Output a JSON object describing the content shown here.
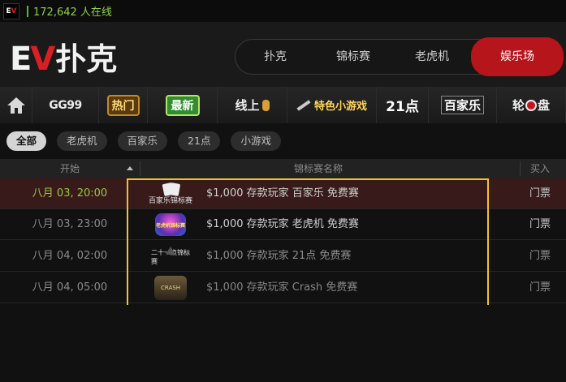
{
  "status_bar": {
    "app_icon_text": "EV",
    "online_text": "172,642 人在线"
  },
  "header": {
    "logo_ev": "EV",
    "logo_title": "扑克",
    "nav": [
      {
        "label": "扑克",
        "active": false
      },
      {
        "label": "锦标赛",
        "active": false
      },
      {
        "label": "老虎机",
        "active": false
      },
      {
        "label": "娱乐场",
        "active": true
      }
    ]
  },
  "categories": [
    {
      "label": "GG99"
    },
    {
      "label": "热门"
    },
    {
      "label": "最新"
    },
    {
      "label": "线上"
    },
    {
      "label": "特色小游戏"
    },
    {
      "label": "21点"
    },
    {
      "label": "百家乐"
    },
    {
      "label_a": "轮",
      "label_b": "盘"
    }
  ],
  "filters": [
    {
      "label": "全部",
      "active": true
    },
    {
      "label": "老虎机",
      "active": false
    },
    {
      "label": "百家乐",
      "active": false
    },
    {
      "label": "21点",
      "active": false
    },
    {
      "label": "小游戏",
      "active": false
    }
  ],
  "table": {
    "columns": {
      "start": "开始",
      "name": "锦标赛名称",
      "buyin": "买入"
    },
    "rows": [
      {
        "start": "八月 03, 20:00",
        "thumb": "百家乐锦标赛",
        "name": "$1,000 存款玩家 百家乐 免费赛",
        "buyin": "门票"
      },
      {
        "start": "八月 03, 23:00",
        "thumb": "老虎机锦标赛",
        "name": "$1,000 存款玩家 老虎机 免费赛",
        "buyin": "门票"
      },
      {
        "start": "八月 04, 02:00",
        "thumb": "二十一点锦标赛",
        "name": "$1,000 存款玩家 21点 免费赛",
        "buyin": "门票"
      },
      {
        "start": "八月 04, 05:00",
        "thumb": "CRASH",
        "name": "$1,000 存款玩家 Crash 免费赛",
        "buyin": "门票"
      }
    ]
  },
  "colors": {
    "accent_red": "#b5151b",
    "online_green": "#8fd13f",
    "highlight_frame": "#f2c230"
  }
}
